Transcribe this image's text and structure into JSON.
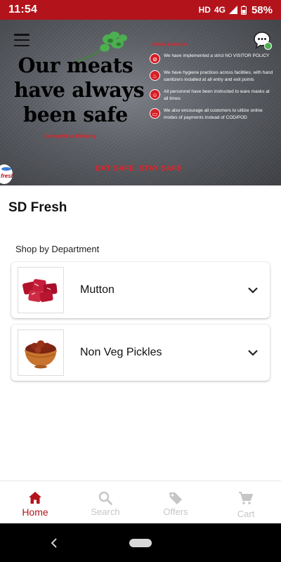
{
  "status_bar": {
    "time": "11:54",
    "network": "HD",
    "signal_type": "4G",
    "battery": "58%"
  },
  "banner": {
    "headline": [
      "Our meats",
      "have always",
      "been safe"
    ],
    "contactless": "Contactless Delivery",
    "safety_title": "Safety Measures",
    "safety_items": [
      "We have implemented a strict NO VISITOR POLICY",
      "We have hygiene practices across facilities, with hand sanitizers installed at all entry and exit points",
      "All personnel have been instructed to ware masks at all times",
      "We also encourage all customers to utilize online modes of payments instead of COD/POD"
    ],
    "tagline": "EAT SAFE. STAY SAFE",
    "logo_text": "fresh",
    "icons": [
      "menu-icon",
      "chat-icon"
    ]
  },
  "store": {
    "name": "SD Fresh"
  },
  "departments": {
    "label": "Shop by Department",
    "items": [
      {
        "name": "Mutton",
        "image": "mutton-image"
      },
      {
        "name": "Non Veg Pickles",
        "image": "pickle-bowl-image"
      }
    ]
  },
  "bottom_nav": {
    "items": [
      {
        "label": "Home",
        "icon": "home-icon",
        "active": true
      },
      {
        "label": "Search",
        "icon": "search-icon",
        "active": false
      },
      {
        "label": "Offers",
        "icon": "tag-icon",
        "active": false
      },
      {
        "label": "Cart",
        "icon": "cart-icon",
        "active": false
      }
    ]
  },
  "colors": {
    "brand": "#b3131b",
    "accent_red": "#e52128",
    "inactive": "#c6c6c6",
    "online_dot": "#4caf50"
  }
}
